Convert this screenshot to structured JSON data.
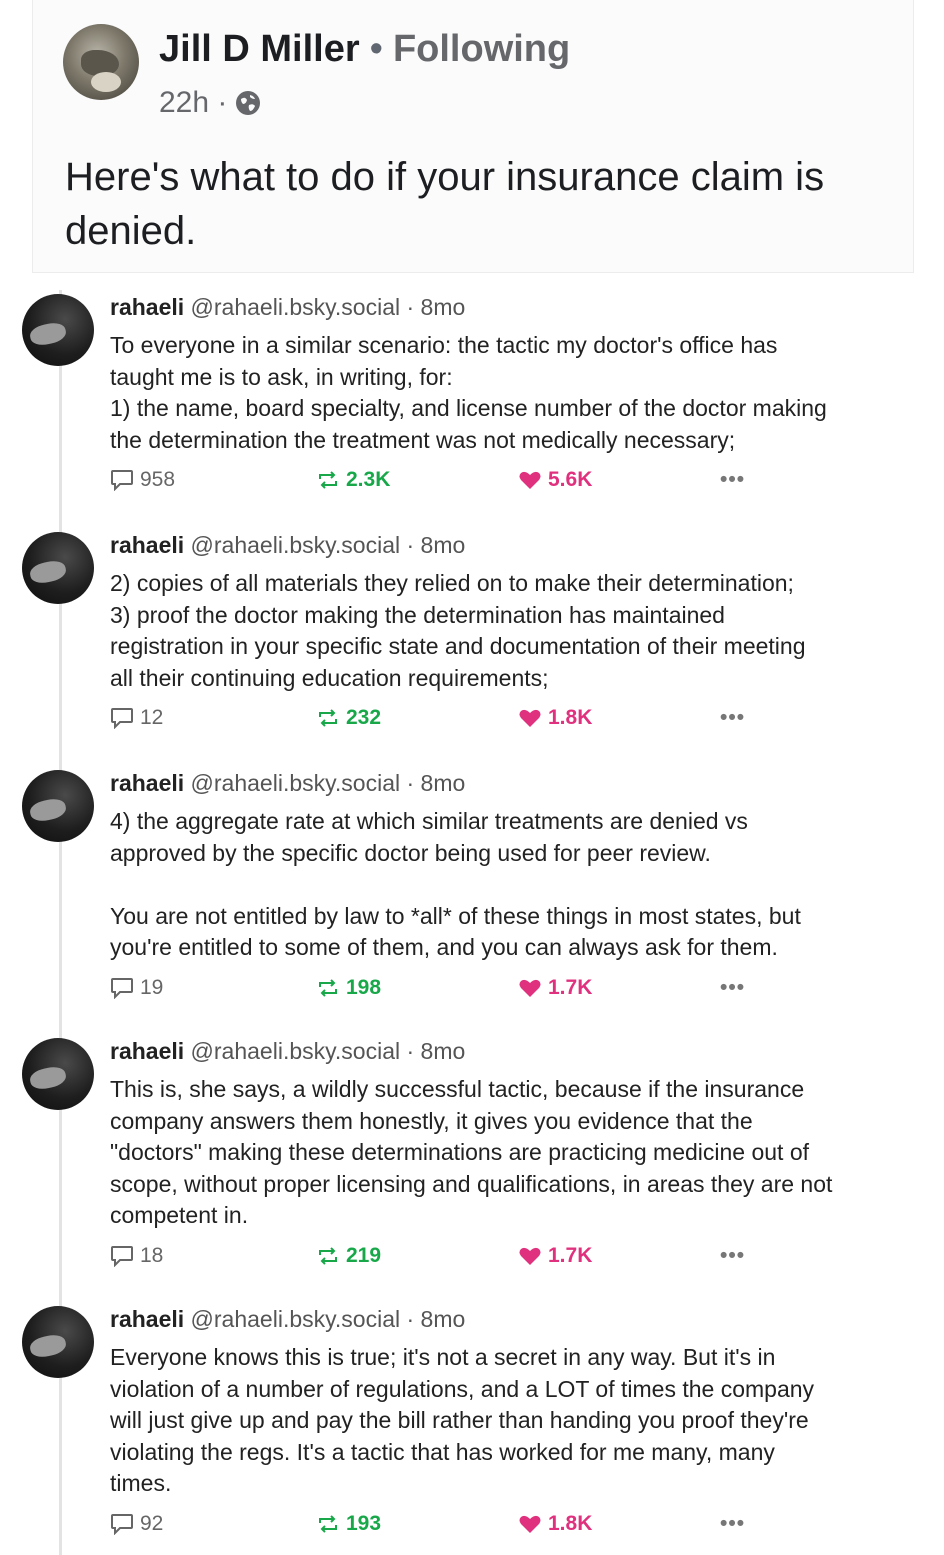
{
  "post": {
    "author": "Jill D Miller",
    "separator": "•",
    "follow_status": "Following",
    "time": "22h ·",
    "text": "Here's what to do if your insurance claim is denied."
  },
  "thread": [
    {
      "name": "rahaeli",
      "handle": "@rahaeli.bsky.social · 8mo",
      "body": "To everyone in a similar scenario: the tactic my doctor's office has\ntaught me is to ask, in writing, for:\n1) the name, board specialty, and license number of the doctor making\nthe determination the treatment was not medically necessary;",
      "replies": "958",
      "reposts": "2.3K",
      "likes": "5.6K",
      "more": "•••"
    },
    {
      "name": "rahaeli",
      "handle": "@rahaeli.bsky.social · 8mo",
      "body": "2) copies of all materials they relied on to make their determination;\n3) proof the doctor making the determination has maintained\nregistration in your specific state and documentation of their meeting\nall their continuing education requirements;",
      "replies": "12",
      "reposts": "232",
      "likes": "1.8K",
      "more": "•••"
    },
    {
      "name": "rahaeli",
      "handle": "@rahaeli.bsky.social · 8mo",
      "body": "4) the aggregate rate at which similar treatments are denied vs\napproved by the specific doctor being used for peer review.\n\nYou are not entitled by law to *all* of these things in most states, but\nyou're entitled to some of them, and you can always ask for them.",
      "replies": "19",
      "reposts": "198",
      "likes": "1.7K",
      "more": "•••"
    },
    {
      "name": "rahaeli",
      "handle": "@rahaeli.bsky.social · 8mo",
      "body": "This is, she says, a wildly successful tactic, because if the insurance\ncompany answers them honestly, it gives you evidence that the\n\"doctors\" making these determinations are practicing medicine out of\nscope, without proper licensing and qualifications, in areas they are not\ncompetent in.",
      "replies": "18",
      "reposts": "219",
      "likes": "1.7K",
      "more": "•••"
    },
    {
      "name": "rahaeli",
      "handle": "@rahaeli.bsky.social · 8mo",
      "body": "Everyone knows this is true; it's not a secret in any way. But it's in\nviolation of a number of regulations, and a LOT of times the company\nwill just give up and pay the bill rather than handing you proof they're\nviolating the regs. It's a tactic that has worked for me many, many\ntimes.",
      "replies": "92",
      "reposts": "193",
      "likes": "1.8K",
      "more": "•••"
    }
  ],
  "colors": {
    "repost": "#18a84a",
    "like": "#e0317e",
    "muted": "#65676b"
  },
  "icons": {
    "reply": "speech-bubble-icon",
    "repost": "repost-arrows-icon",
    "like": "heart-icon",
    "more": "more-dots-icon",
    "privacy": "globe-icon"
  }
}
